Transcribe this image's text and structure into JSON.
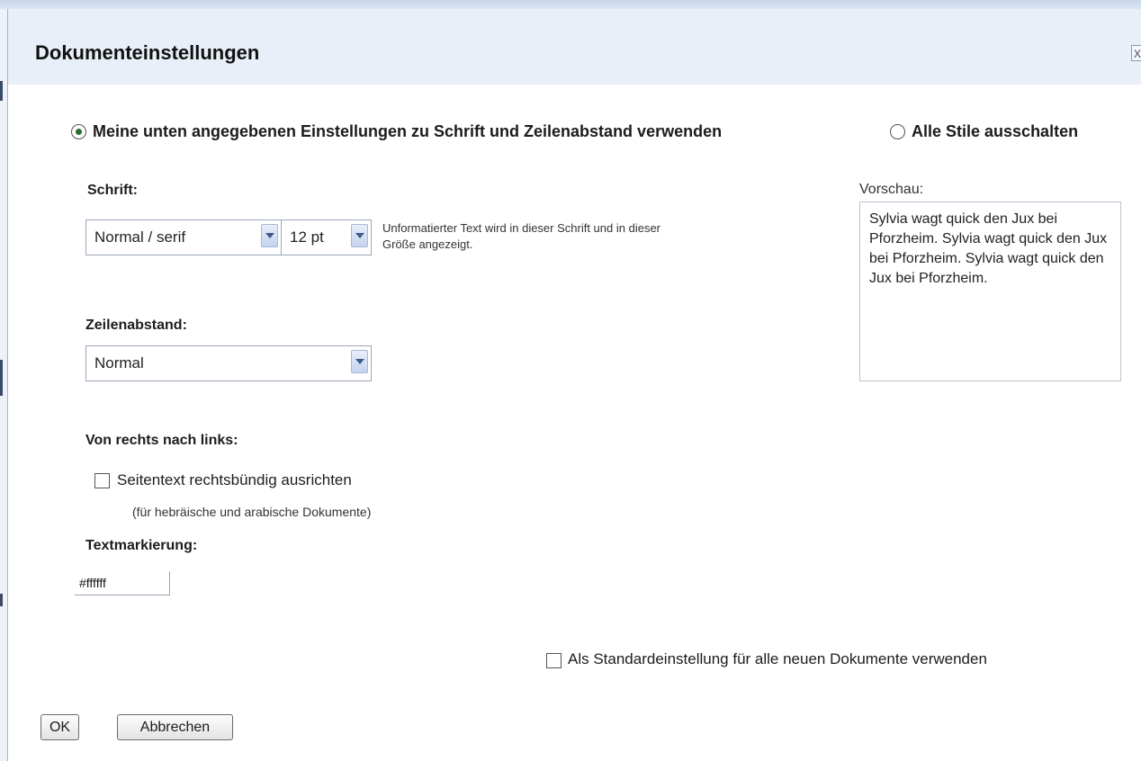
{
  "dialog": {
    "title": "Dokumenteinstellungen",
    "close_label": "X"
  },
  "mode": {
    "custom_label": "Meine unten angegebenen Einstellungen zu Schrift und Zeilenabstand verwenden",
    "custom_selected": true,
    "off_label": "Alle Stile ausschalten",
    "off_selected": false
  },
  "font": {
    "section_label": "Schrift:",
    "family_value": "Normal / serif",
    "size_value": "12 pt",
    "hint_line1": "Unformatierter Text wird in dieser Schrift und in dieser",
    "hint_line2": "Größe angezeigt."
  },
  "line_spacing": {
    "section_label": "Zeilenabstand:",
    "value": "Normal"
  },
  "rtl": {
    "section_label": "Von rechts nach links:",
    "checkbox_label": "Seitentext rechtsbündig ausrichten",
    "checked": false,
    "note": "(für hebräische und arabische Dokumente)"
  },
  "highlight": {
    "section_label": "Textmarkierung:",
    "value": "#ffffff"
  },
  "preview": {
    "label": "Vorschau:",
    "text": "Sylvia wagt quick den Jux bei Pforzheim. Sylvia wagt quick den Jux bei Pforzheim. Sylvia wagt quick den Jux bei Pforzheim."
  },
  "default_option": {
    "label": "Als Standardeinstellung für alle neuen Dokumente verwenden",
    "checked": false
  },
  "buttons": {
    "ok": "OK",
    "cancel": "Abbrechen"
  }
}
